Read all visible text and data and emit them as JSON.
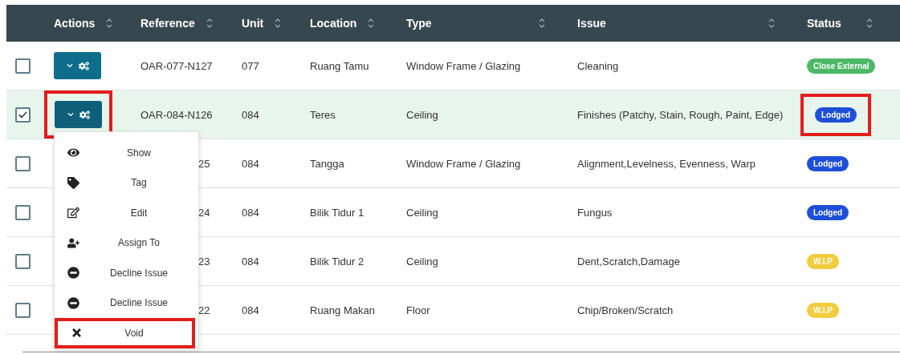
{
  "table": {
    "columns": [
      {
        "label": "Actions"
      },
      {
        "label": "Reference"
      },
      {
        "label": "Unit"
      },
      {
        "label": "Location"
      },
      {
        "label": "Type"
      },
      {
        "label": "Issue"
      },
      {
        "label": "Status"
      }
    ],
    "rows": [
      {
        "checked": false,
        "selected": false,
        "menu_open": false,
        "button_highlighted": false,
        "reference": "OAR-077-N127",
        "reference_covered": false,
        "unit": "077",
        "location": "Ruang Tamu",
        "type": "Window Frame / Glazing",
        "issue": "Cleaning",
        "status": {
          "label": "Close External",
          "color": "#4cb865",
          "highlighted": false
        }
      },
      {
        "checked": true,
        "selected": true,
        "menu_open": true,
        "button_highlighted": true,
        "reference": "OAR-084-N126",
        "reference_covered": false,
        "unit": "084",
        "location": "Teres",
        "type": "Ceiling",
        "issue": "Finishes (Patchy, Stain, Rough, Paint, Edge)",
        "status": {
          "label": "Lodged",
          "color": "#1d4fd8",
          "highlighted": true
        }
      },
      {
        "checked": false,
        "selected": false,
        "menu_open": false,
        "button_highlighted": false,
        "reference": "25",
        "reference_covered": true,
        "unit": "084",
        "location": "Tangga",
        "type": "Window Frame / Glazing",
        "issue": "Alignment,Levelness, Evenness, Warp",
        "status": {
          "label": "Lodged",
          "color": "#1d4fd8",
          "highlighted": false
        }
      },
      {
        "checked": false,
        "selected": false,
        "menu_open": false,
        "button_highlighted": false,
        "reference": "24",
        "reference_covered": true,
        "unit": "084",
        "location": "Bilik Tidur 1",
        "type": "Ceiling",
        "issue": "Fungus",
        "status": {
          "label": "Lodged",
          "color": "#1d4fd8",
          "highlighted": false
        }
      },
      {
        "checked": false,
        "selected": false,
        "menu_open": false,
        "button_highlighted": false,
        "reference": "23",
        "reference_covered": true,
        "unit": "084",
        "location": "Bilik Tidur 2",
        "type": "Ceiling",
        "issue": "Dent,Scratch,Damage",
        "status": {
          "label": "W.I.P",
          "color": "#f2cc3c",
          "highlighted": false
        }
      },
      {
        "checked": false,
        "selected": false,
        "menu_open": false,
        "button_highlighted": false,
        "reference": "22",
        "reference_covered": true,
        "unit": "084",
        "location": "Ruang Makan",
        "type": "Floor",
        "issue": "Chip/Broken/Scratch",
        "status": {
          "label": "W.I.P",
          "color": "#f2cc3c",
          "highlighted": false
        }
      }
    ]
  },
  "action_menu": {
    "items": [
      {
        "kind": "show",
        "label": "Show",
        "highlighted": false
      },
      {
        "kind": "tag",
        "label": "Tag",
        "highlighted": false
      },
      {
        "kind": "edit",
        "label": "Edit",
        "highlighted": false
      },
      {
        "kind": "assign",
        "label": "Assign To",
        "highlighted": false
      },
      {
        "kind": "decline",
        "label": "Decline Issue",
        "highlighted": false
      },
      {
        "kind": "decline",
        "label": "Decline Issue",
        "highlighted": false
      },
      {
        "kind": "void",
        "label": "Void",
        "highlighted": true
      }
    ]
  }
}
